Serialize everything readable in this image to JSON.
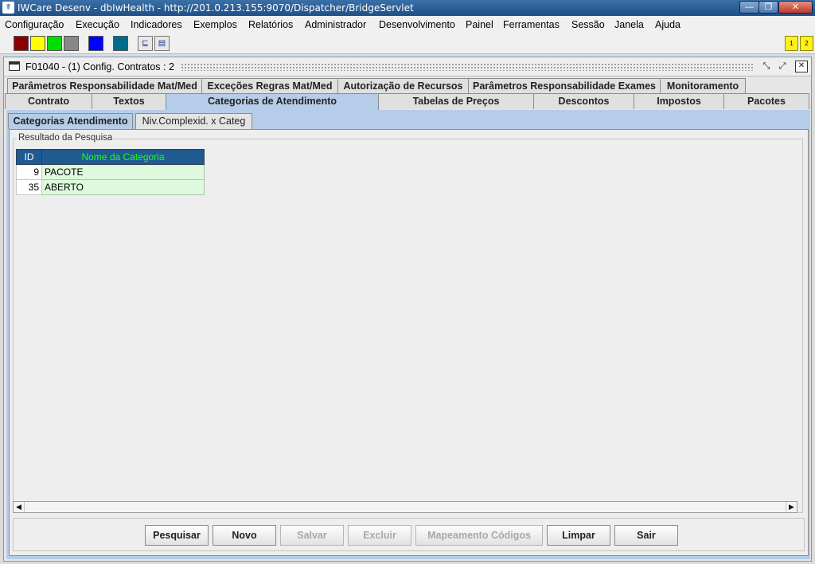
{
  "window": {
    "title": "IWCare Desenv - dbIwHealth - http://201.0.213.155:9070/Dispatcher/BridgeServlet",
    "app_icon": "app-icon",
    "controls": {
      "minimize": "—",
      "maximize": "❐",
      "close": "✕"
    }
  },
  "menu": [
    "Configuração",
    "Execução",
    "Indicadores",
    "Exemplos",
    "Relatórios",
    "Administrador",
    "Desenvolvimento",
    "Painel",
    "Ferramentas",
    "Sessão",
    "Janela",
    "Ajuda"
  ],
  "toolbar": {
    "color_swatches": [
      "#8b0000",
      "#ffff00",
      "#00dd00",
      "#888888",
      "#0000ff",
      "#006c8c"
    ],
    "tool_icons": [
      "tree-icon",
      "window-list-icon"
    ],
    "indicators": [
      "1",
      "2"
    ]
  },
  "frame": {
    "title": "F01040 - (1) Config. Contratos : 2",
    "controls": {
      "minimize": "⤡",
      "maximize": "⤢",
      "close": "✕"
    }
  },
  "tabs_row1": [
    "Parâmetros Responsabilidade Mat/Med",
    "Exceções Regras Mat/Med",
    "Autorização de Recursos",
    "Parâmetros Responsabilidade Exames",
    "Monitoramento"
  ],
  "tabs_row2": [
    "Contrato",
    "Textos",
    "Categorias de Atendimento",
    "Tabelas de Preços",
    "Descontos",
    "Impostos",
    "Pacotes"
  ],
  "selected_tab": "Categorias de Atendimento",
  "subtabs": [
    "Categorias Atendimento",
    "Niv.Complexid. x Categ"
  ],
  "results": {
    "legend": "Resultado da Pesquisa",
    "columns": [
      "ID",
      "Nome da Categoria"
    ],
    "rows": [
      {
        "id": "9",
        "name": "PACOTE"
      },
      {
        "id": "35",
        "name": "ABERTO"
      }
    ]
  },
  "scroll": {
    "left_arrow": "◀",
    "right_arrow": "▶"
  },
  "buttons": {
    "pesquisar": "Pesquisar",
    "novo": "Novo",
    "salvar": "Salvar",
    "excluir": "Excluir",
    "mapeamento": "Mapeamento Códigos",
    "limpar": "Limpar",
    "sair": "Sair"
  },
  "colors": {
    "header_bg": "#1f5a91",
    "header_text": "#1cff1c",
    "row_bg": "#ddfadd",
    "selected_tab": "#b5cde8"
  }
}
